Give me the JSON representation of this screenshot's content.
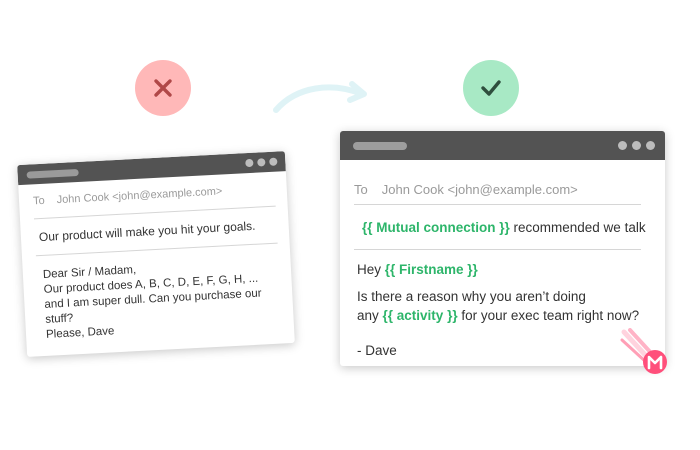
{
  "bad_example": {
    "badge_icon": "x-icon",
    "badge_color": "#ffb8b8",
    "to_label": "To",
    "to_value": "John Cook <john@example.com>",
    "subject": "Our product will make you hit your goals.",
    "body_lines": [
      "Dear Sir / Madam,",
      "Our product does A, B, C, D, E, F, G, H, ...",
      "and I am super dull. Can you purchase our",
      "stuff?",
      "Please, Dave"
    ]
  },
  "good_example": {
    "badge_icon": "checkmark-icon",
    "badge_color": "#a8e9c5",
    "to_label": "To",
    "to_value": "John Cook <john@example.com>",
    "mutual_token": "{{ Mutual connection }}",
    "mutual_rest": " recommended we talk",
    "hey_word": "Hey ",
    "firstname_token": "{{ Firstname }}",
    "line1": "Is there a reason why you aren’t doing",
    "line2_start": "any ",
    "activity_token": "{{ activity }}",
    "line2_end": " for your exec team right now?",
    "signature": "- Dave"
  },
  "decor": {
    "arrow_icon": "curved-arrow-icon",
    "meteor_icon": "meteor-logo-icon",
    "highlight_color": "#2db56a"
  }
}
